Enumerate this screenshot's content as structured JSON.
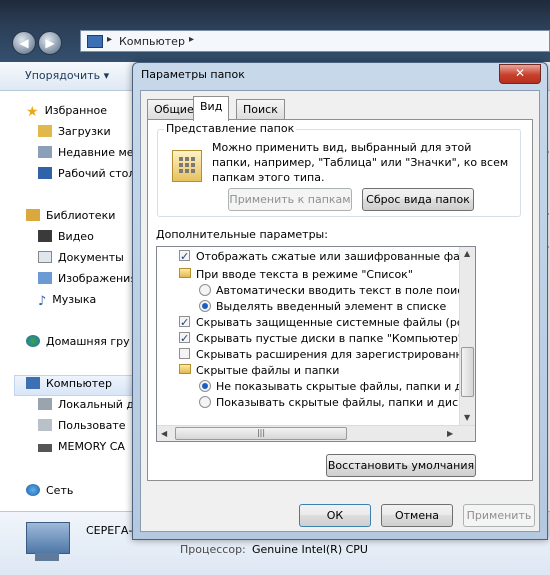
{
  "explorer": {
    "address": {
      "crumb": "Компьютер"
    },
    "toolbar": {
      "organize": "Упорядочить ▾"
    },
    "sidebar": {
      "items": [
        {
          "label": "Избранное",
          "icon": "star-icon"
        },
        {
          "label": "Загрузки",
          "icon": "downloads-folder-icon"
        },
        {
          "label": "Недавние ме",
          "icon": "recent-places-icon"
        },
        {
          "label": "Рабочий стол",
          "icon": "desktop-icon"
        },
        {
          "label": "Библиотеки",
          "icon": "libraries-icon"
        },
        {
          "label": "Видео",
          "icon": "video-icon"
        },
        {
          "label": "Документы",
          "icon": "documents-icon"
        },
        {
          "label": "Изображения",
          "icon": "pictures-icon"
        },
        {
          "label": "Музыка",
          "icon": "music-icon"
        },
        {
          "label": "Домашняя гру",
          "icon": "homegroup-icon"
        },
        {
          "label": "Компьютер",
          "icon": "computer-icon"
        },
        {
          "label": "Локальный д",
          "icon": "local-disk-icon"
        },
        {
          "label": "Пользовате",
          "icon": "drive-icon"
        },
        {
          "label": "MEMORY CA",
          "icon": "memory-card-icon"
        },
        {
          "label": "Сеть",
          "icon": "network-icon"
        }
      ]
    },
    "details": {
      "name": "СЕРЕГА-",
      "cpu_label": "Процессор:",
      "cpu_value": "Genuine Intel(R) CPU"
    }
  },
  "dialog": {
    "title": "Параметры папок",
    "close": "✕",
    "tabs": [
      {
        "label": "Общие"
      },
      {
        "label": "Вид"
      },
      {
        "label": "Поиск"
      }
    ],
    "group": {
      "title": "Представление папок",
      "desc": "Можно применить вид, выбранный для этой папки, например, \"Таблица\" или \"Значки\", ко всем папкам этого типа.",
      "apply_label": "Применить к папкам",
      "reset_label": "Сброс вида папок"
    },
    "advanced_label": "Дополнительные параметры:",
    "tree": [
      {
        "kind": "check",
        "checked": true,
        "label": "Отображать сжатые или зашифрованные файлы NTI"
      },
      {
        "kind": "folder",
        "label": "При вводе текста в режиме \"Список\""
      },
      {
        "kind": "radio",
        "checked": false,
        "label": "Автоматически вводить текст в поле поиска"
      },
      {
        "kind": "radio",
        "checked": true,
        "label": "Выделять введенный элемент в списке"
      },
      {
        "kind": "check",
        "checked": true,
        "label": "Скрывать защищенные системные файлы (рекомен,"
      },
      {
        "kind": "check",
        "checked": true,
        "label": "Скрывать пустые диски в папке \"Компьютер\""
      },
      {
        "kind": "check",
        "checked": false,
        "label": "Скрывать расширения для зарегистрированных типо"
      },
      {
        "kind": "folder",
        "label": "Скрытые файлы и папки"
      },
      {
        "kind": "radio",
        "checked": true,
        "label": "Не показывать скрытые файлы, папки и диски"
      },
      {
        "kind": "radio",
        "checked": false,
        "label": "Показывать скрытые файлы, папки и диски"
      }
    ],
    "restore_label": "Восстановить умолчания",
    "ok_label": "ОК",
    "cancel_label": "Отмена",
    "apply_label": "Применить"
  }
}
